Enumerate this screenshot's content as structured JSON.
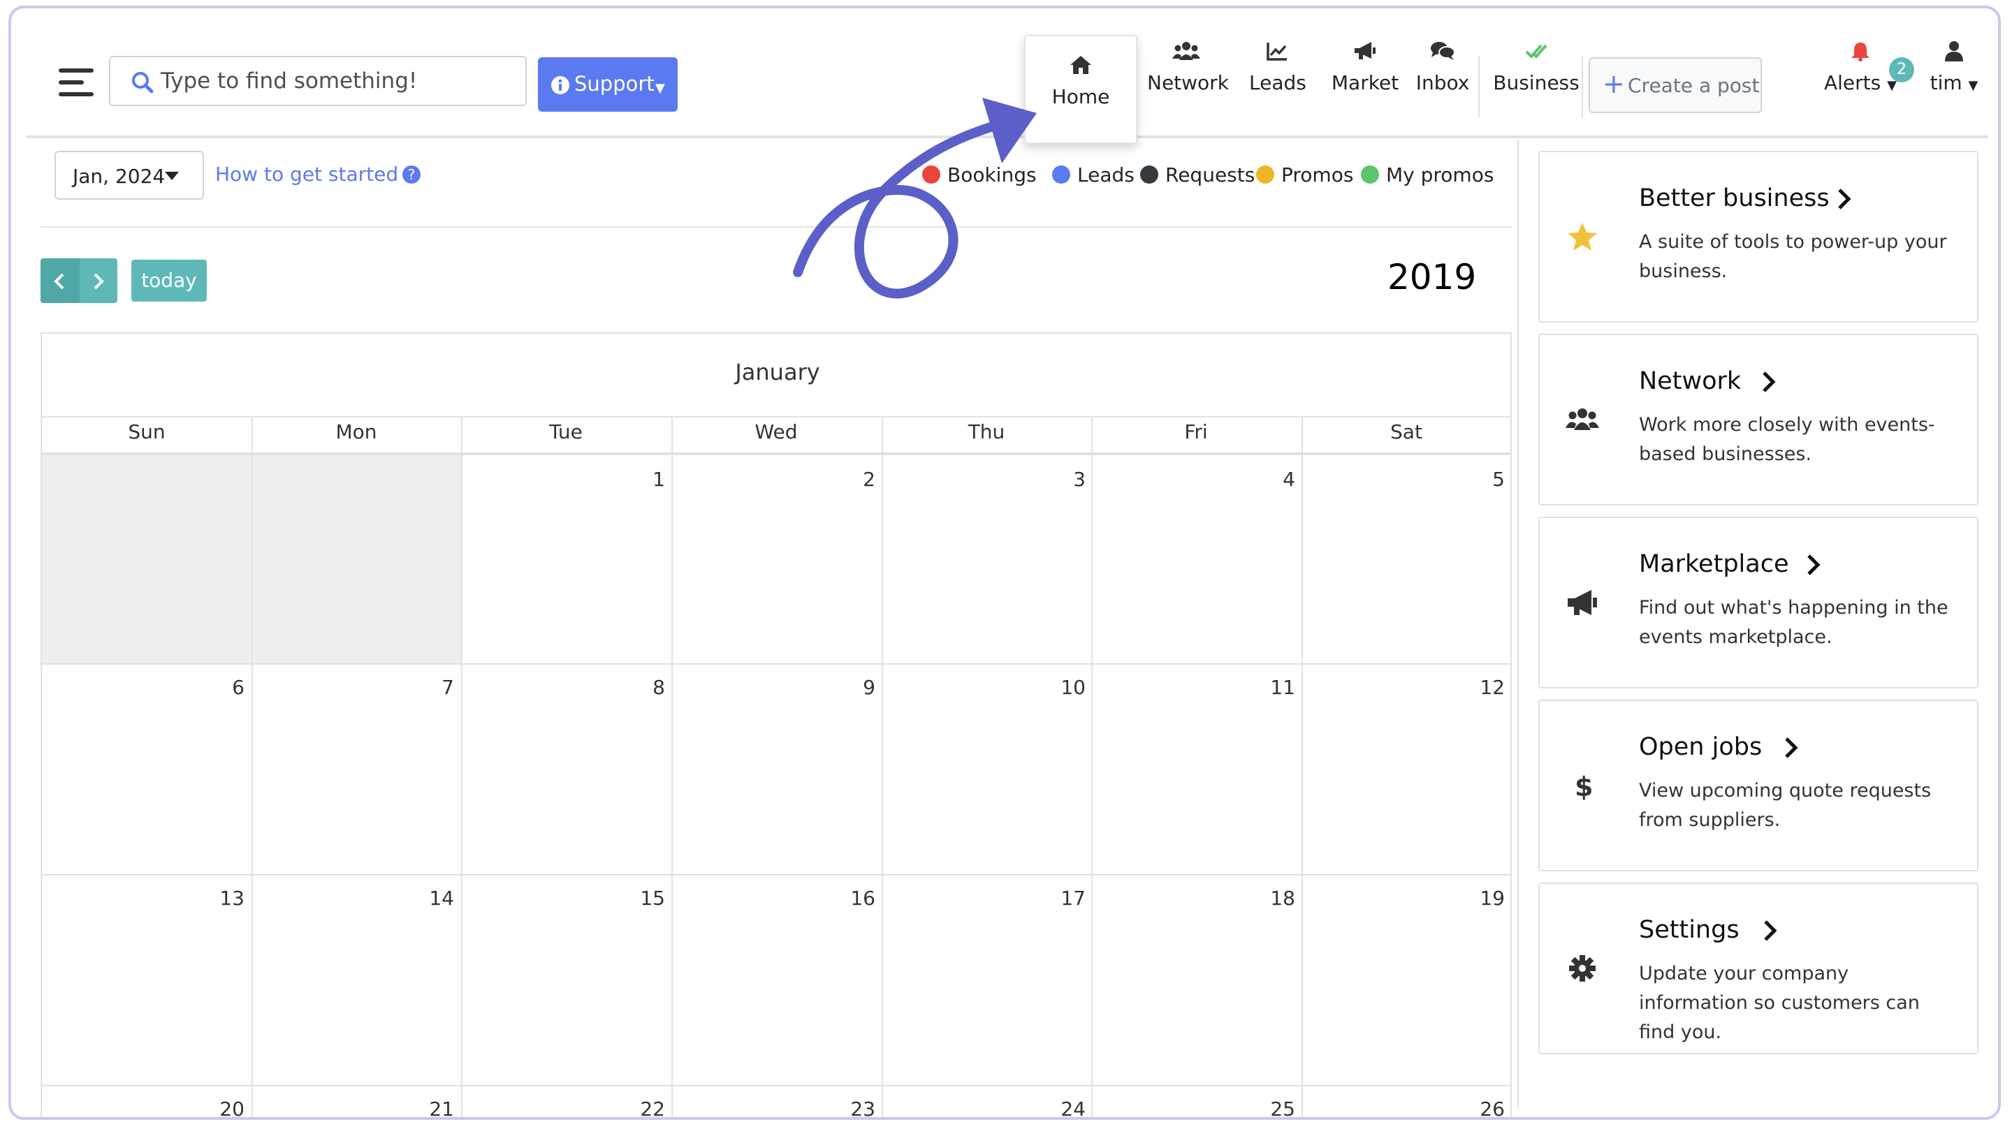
{
  "search": {
    "placeholder": "Type to find something!"
  },
  "support": {
    "label": "Support"
  },
  "nav": {
    "home": "Home",
    "network": "Network",
    "leads": "Leads",
    "market": "Market",
    "inbox": "Inbox",
    "business": "Business"
  },
  "create_post": {
    "label": "Create a post"
  },
  "alerts": {
    "label": "Alerts",
    "count": "2"
  },
  "user": {
    "name": "tim"
  },
  "calendar": {
    "month_selector": "Jan, 2024",
    "how_to": "How to get started",
    "legend": [
      {
        "label": "Bookings",
        "color": "#e8453c"
      },
      {
        "label": "Leads",
        "color": "#5b79f0"
      },
      {
        "label": "Requests",
        "color": "#343a40"
      },
      {
        "label": "Promos",
        "color": "#f0b429"
      },
      {
        "label": "My promos",
        "color": "#5cc46c"
      }
    ],
    "today_label": "today",
    "year": "2019",
    "month_title": "January",
    "weekdays": [
      "Sun",
      "Mon",
      "Tue",
      "Wed",
      "Thu",
      "Fri",
      "Sat"
    ],
    "days": [
      "1",
      "2",
      "3",
      "4",
      "5",
      "6",
      "7",
      "8",
      "9",
      "10",
      "11",
      "12",
      "13",
      "14",
      "15",
      "16",
      "17",
      "18",
      "19",
      "20",
      "21",
      "22",
      "23",
      "24",
      "25",
      "26"
    ]
  },
  "cards": [
    {
      "title": "Better business",
      "desc": "A suite of tools to power-up your business.",
      "icon": "star-icon"
    },
    {
      "title": "Network",
      "desc": "Work more closely with events-based businesses.",
      "icon": "users-icon"
    },
    {
      "title": "Marketplace",
      "desc": "Find out what's happening in the events marketplace.",
      "icon": "megaphone-icon"
    },
    {
      "title": "Open jobs",
      "desc": "View upcoming quote requests from suppliers.",
      "icon": "dollar-icon"
    },
    {
      "title": "Settings",
      "desc": "Update your company information so customers can find you.",
      "icon": "gear-icon"
    }
  ],
  "colors": {
    "accent": "#5b79f0",
    "teal": "#5fb8b8",
    "annotation": "#5b5fc7",
    "star": "#f0c23c"
  }
}
